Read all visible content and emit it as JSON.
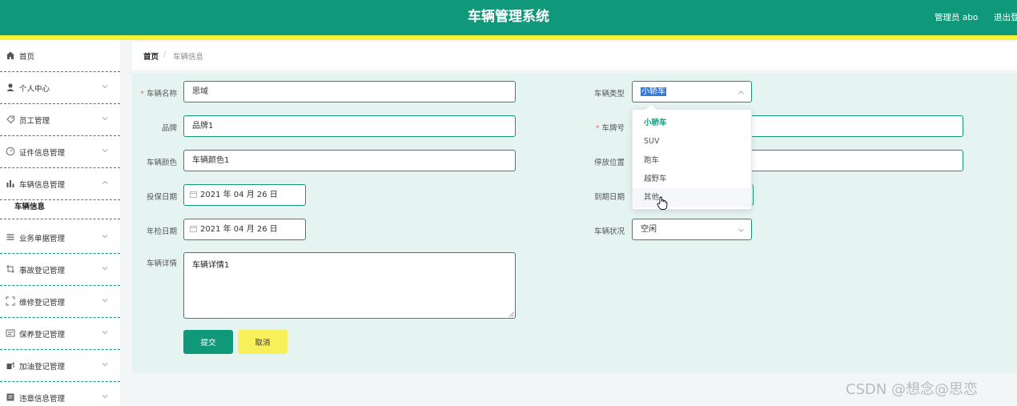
{
  "header": {
    "title": "车辆管理系统",
    "user": "管理员 abo",
    "logout": "退出登录",
    "bg_color": "#0f987a",
    "strip_color": "#f7f03d"
  },
  "sidebar": {
    "items": [
      {
        "label": "首页",
        "icon": "home-icon"
      },
      {
        "label": "个人中心",
        "icon": "user-icon"
      },
      {
        "label": "员工管理",
        "icon": "tag-icon"
      },
      {
        "label": "证件信息管理",
        "icon": "gauge-icon"
      },
      {
        "label": "车辆信息管理",
        "icon": "chart-icon"
      },
      {
        "label": "业务单据管理",
        "icon": "menu-icon"
      },
      {
        "label": "事故登记管理",
        "icon": "crop-icon"
      },
      {
        "label": "维修登记管理",
        "icon": "fullscreen-icon"
      },
      {
        "label": "保养登记管理",
        "icon": "message-icon"
      },
      {
        "label": "加油登记管理",
        "icon": "fuel-icon"
      },
      {
        "label": "违章信息管理",
        "icon": "list-icon"
      }
    ],
    "sub_item": "车辆信息"
  },
  "breadcrumb": {
    "home": "首页",
    "separator": "/",
    "current": "车辆信息"
  },
  "form": {
    "name_label": "车辆名称",
    "name_value": "思域",
    "brand_label": "品牌",
    "brand_value": "品牌1",
    "color_label": "车辆颜色",
    "color_value": "车辆颜色1",
    "insure_label": "投保日期",
    "insure_value": "2021 年 04 月 26 日",
    "inspect_label": "年检日期",
    "inspect_value": "2021 年 04 月 26 日",
    "detail_label": "车辆详情",
    "detail_value": "车辆详情1",
    "type_label": "车辆类型",
    "type_value": "小轿车",
    "plate_label": "车牌号",
    "parking_label": "停放位置",
    "expire_label": "到期日期",
    "status_label": "车辆状况",
    "status_value": "空闲",
    "submit": "提交",
    "cancel": "取消"
  },
  "dropdown": {
    "options": [
      "小轿车",
      "SUV",
      "跑车",
      "越野车",
      "其他"
    ],
    "selected": "小轿车",
    "hovered": "其他"
  },
  "watermark": "CSDN @想念@思恋"
}
